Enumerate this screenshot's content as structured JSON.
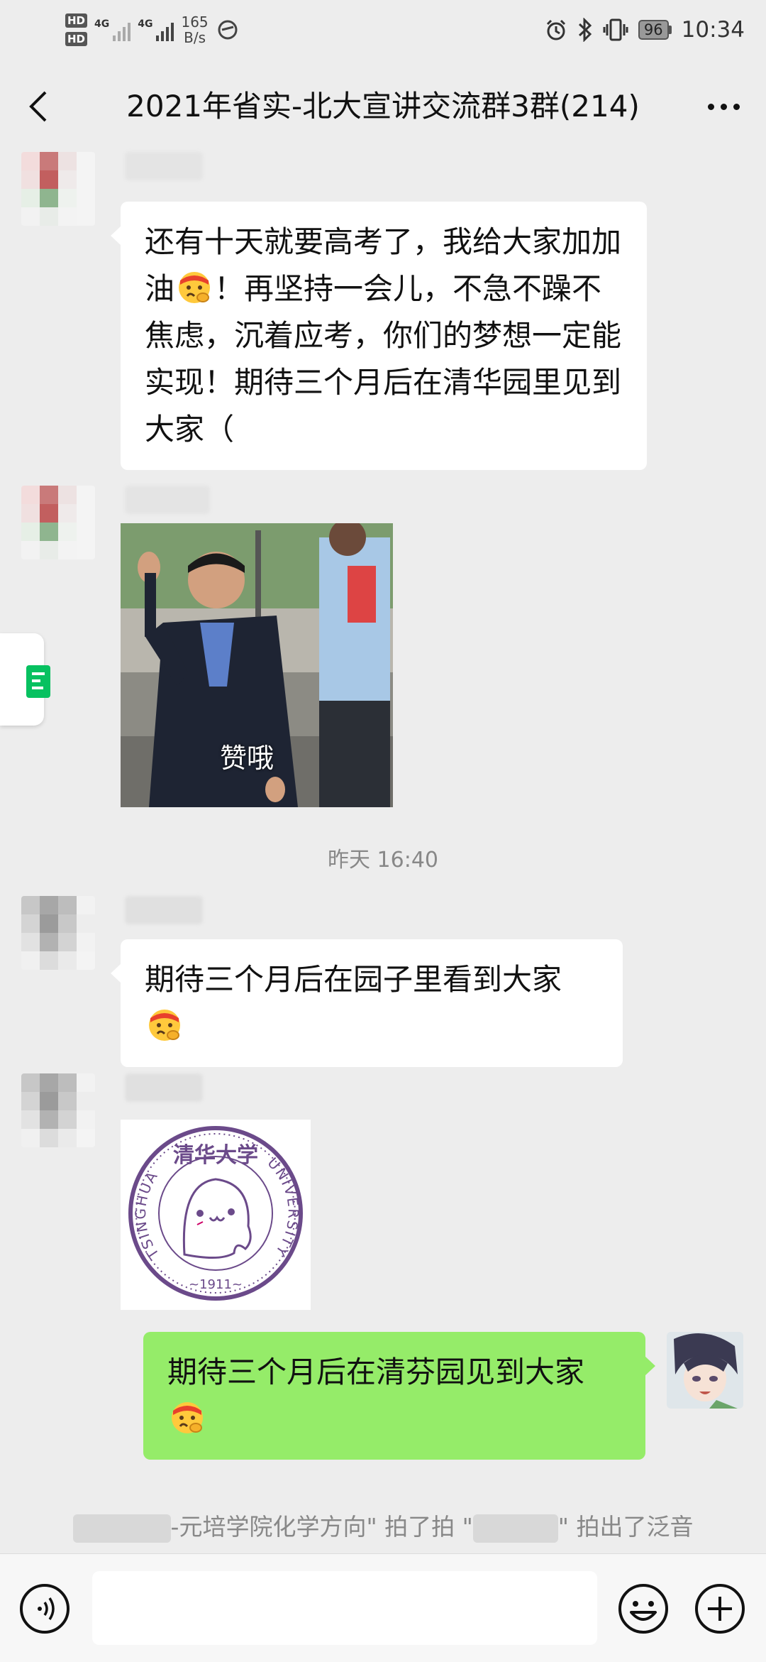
{
  "status_bar": {
    "hd1": "HD",
    "hd2": "HD",
    "net1": "4G",
    "net2": "4G",
    "speed_value": "165",
    "speed_unit": "B/s",
    "battery": "96",
    "time": "10:34"
  },
  "header": {
    "title": "2021年省实-北大宣讲交流群3群(214)"
  },
  "messages": [
    {
      "text_before": "还有十天就要高考了，我给大家加加油",
      "text_after": "！再坚持一会儿，不急不躁不焦虑，沉着应考，你们的梦想一定能实现！期待三个月后在清华园里见到大家（",
      "emoji": "fighting-face-emoji"
    },
    {
      "sticker_caption": "赞哦"
    },
    {
      "text": "期待三个月后在园子里看到大家",
      "emoji": "fighting-face-emoji"
    },
    {
      "seal_top": "清华大学",
      "seal_left": "TSINGHUA",
      "seal_right": "UNIVERSITY",
      "seal_year": "~1911~"
    },
    {
      "text": "期待三个月后在清芬园见到大家",
      "emoji": "fighting-face-emoji"
    }
  ],
  "timestamp": "昨天 16:40",
  "system_notice": {
    "part1": "-元培学院化学方向\" 拍了拍 \"",
    "part2": "\" 拍出了泛音"
  },
  "input_bar": {
    "placeholder": ""
  },
  "colors": {
    "background": "#ededed",
    "self_bubble": "#95ec69",
    "other_bubble": "#ffffff",
    "accent_green": "#07c160"
  }
}
